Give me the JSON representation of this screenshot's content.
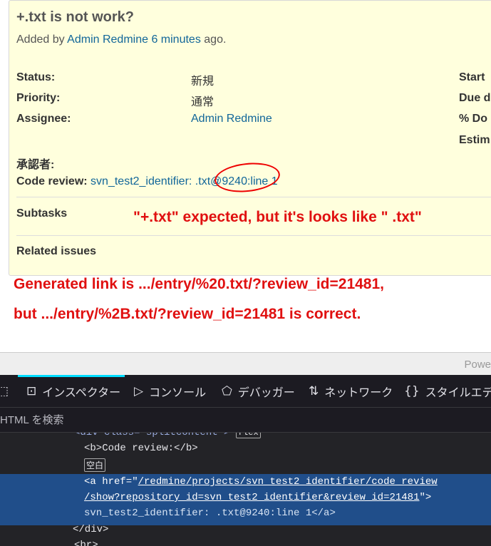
{
  "issue": {
    "title": "+.txt is not work?",
    "added_by_prefix": "Added by",
    "author": "Admin Redmine",
    "age": "6 minutes",
    "added_by_suffix": "ago.",
    "attributes": {
      "status_label": "Status:",
      "status_value": "新規",
      "priority_label": "Priority:",
      "priority_value": "通常",
      "assignee_label": "Assignee:",
      "assignee_value": "Admin Redmine",
      "start_label": "Start",
      "due_label": "Due d",
      "done_label": "% Do",
      "estimated_label": "Estim",
      "approver_label": "承認者:"
    },
    "code_review": {
      "label": "Code review:",
      "link_text": "svn_test2_identifier: .txt@9240:line 1"
    },
    "subtasks_label": "Subtasks",
    "related_label": "Related issues"
  },
  "annotations": {
    "note1": "\"+.txt\" expected, but it's looks like \" .txt\"",
    "note2": "Generated link is .../entry/%20.txt/?review_id=21481,",
    "note3": "but .../entry/%2B.txt/?review_id=21481 is correct."
  },
  "footer": {
    "powered": "Powe"
  },
  "devtools": {
    "tabs": [
      {
        "label": "インスペクター",
        "icon": "inspector-icon",
        "active": true
      },
      {
        "label": "コンソール",
        "icon": "console-icon",
        "active": false
      },
      {
        "label": "デバッガー",
        "icon": "debugger-icon",
        "active": false
      },
      {
        "label": "ネットワーク",
        "icon": "network-icon",
        "active": false
      },
      {
        "label": "スタイルエディ",
        "icon": "style-editor-icon",
        "active": false
      }
    ],
    "search_placeholder": "HTML を検索",
    "tree": {
      "line0": "<div class=\"splitcontent\">",
      "line0_badge": "flex",
      "line1_open": "<b>",
      "line1_text": "Code review:",
      "line1_close": "</b>",
      "whitespace_badge": "空白",
      "sel_line1_prefix": "<a href=\"",
      "sel_href1": "/redmine/projects/svn_test2_identifier/code_review",
      "sel_href2": "/show?repository_id=svn_test2_identifier&review_id=21481",
      "sel_line2_suffix": "\">",
      "sel_line3": "svn_test2_identifier: .txt@9240:line 1</a>",
      "close_div": "</div>",
      "next_tag": "<br>"
    }
  },
  "colors": {
    "issue_bg": "#ffffdd",
    "link": "#116699",
    "annotation": "#e01010",
    "devtools_bg": "#1c1b22",
    "selection": "#204e8a"
  }
}
